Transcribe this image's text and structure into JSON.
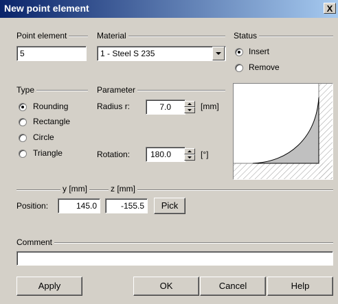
{
  "window": {
    "title": "New point element",
    "close_symbol": "X"
  },
  "point_element": {
    "label": "Point element",
    "value": "5"
  },
  "material": {
    "label": "Material",
    "selected": "1 - Steel S 235"
  },
  "status": {
    "label": "Status",
    "options": [
      {
        "label": "Insert",
        "selected": true
      },
      {
        "label": "Remove",
        "selected": false
      }
    ]
  },
  "type": {
    "label": "Type",
    "options": [
      {
        "label": "Rounding",
        "selected": true
      },
      {
        "label": "Rectangle",
        "selected": false
      },
      {
        "label": "Circle",
        "selected": false
      },
      {
        "label": "Triangle",
        "selected": false
      }
    ]
  },
  "parameter": {
    "label": "Parameter",
    "radius": {
      "label": "Radius r:",
      "value": "7.0",
      "unit": "[mm]"
    },
    "rotation": {
      "label": "Rotation:",
      "value": "180.0",
      "unit": "[°]"
    }
  },
  "position": {
    "label": "Position:",
    "y_label": "y [mm]",
    "z_label": "z [mm]",
    "y_value": "145.0",
    "z_value": "-155.5",
    "pick_label": "Pick"
  },
  "comment": {
    "label": "Comment",
    "value": ""
  },
  "buttons": {
    "apply": "Apply",
    "ok": "OK",
    "cancel": "Cancel",
    "help": "Help"
  },
  "colors": {
    "titlebar_start": "#0a246a",
    "titlebar_end": "#a6caf0",
    "dialog_bg": "#d4d0c8",
    "shape_fill": "#c0c0c0"
  }
}
